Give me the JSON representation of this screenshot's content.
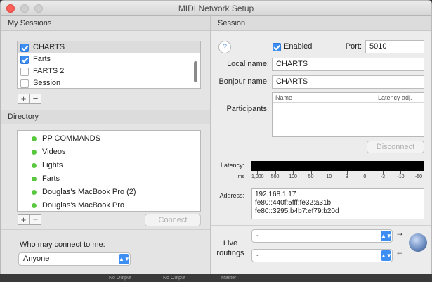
{
  "window": {
    "title": "MIDI Network Setup"
  },
  "my_sessions": {
    "header": "My Sessions",
    "items": [
      {
        "label": "CHARTS",
        "checked": true,
        "selected": true
      },
      {
        "label": "Farts",
        "checked": true,
        "selected": false
      },
      {
        "label": "FARTS 2",
        "checked": false,
        "selected": false
      },
      {
        "label": "Session",
        "checked": false,
        "selected": false
      }
    ],
    "add_label": "+",
    "remove_label": "−"
  },
  "directory": {
    "header": "Directory",
    "items": [
      "PP COMMANDS",
      "Videos",
      "Lights",
      "Farts",
      "Douglas's MacBook Pro (2)",
      "Douglas's MacBook Pro"
    ],
    "add_label": "+",
    "remove_label": "−",
    "connect_label": "Connect"
  },
  "who_may_connect": {
    "label": "Who may connect to me:",
    "value": "Anyone"
  },
  "session": {
    "header": "Session",
    "help_label": "?",
    "enabled_label": "Enabled",
    "enabled": true,
    "port_label": "Port:",
    "port_value": "5010",
    "local_name_label": "Local name:",
    "local_name_value": "CHARTS",
    "bonjour_name_label": "Bonjour name:",
    "bonjour_name_value": "CHARTS",
    "participants_label": "Participants:",
    "participants_columns": [
      "Name",
      "Latency adj."
    ],
    "disconnect_label": "Disconnect",
    "latency_label": "Latency:",
    "latency_unit": "ms",
    "latency_ticks": [
      "1,000",
      "500",
      "100",
      "50",
      "10",
      "3",
      "0",
      "-3",
      "-10",
      "-50"
    ],
    "address_label": "Address:",
    "addresses": [
      "192.168.1.17",
      "fe80::440f:5fff:fe32:a31b",
      "fe80::3295:b4b7:ef79:b20d"
    ],
    "live_routings_label": "Live routings",
    "routing_in_value": "-",
    "routing_out_value": "-"
  },
  "taskbar": {
    "items": [
      "No Output",
      "No Output",
      "Master"
    ]
  },
  "colors": {
    "accent": "#3d8ef3",
    "online_dot": "#5ac83e"
  }
}
